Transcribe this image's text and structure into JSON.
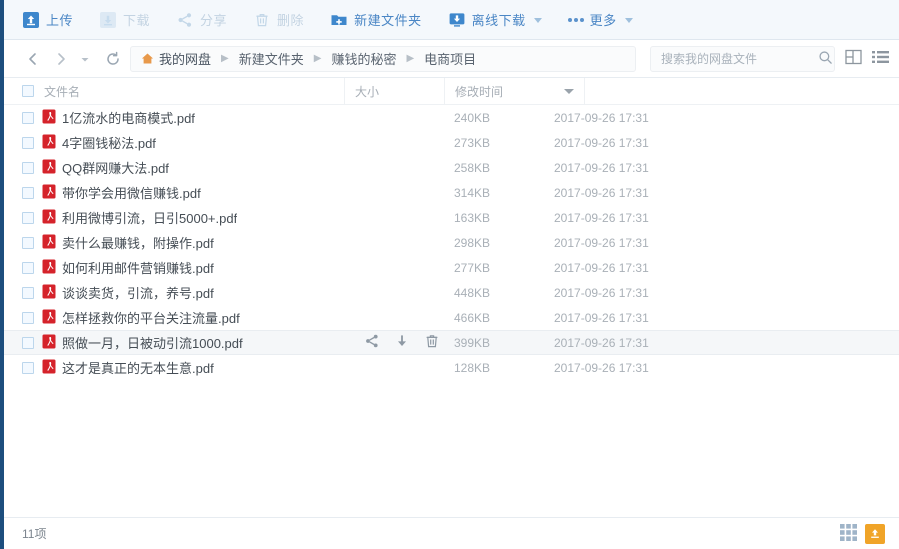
{
  "toolbar": {
    "buttons": [
      {
        "label": "上传",
        "icon": "upload-icon",
        "disabled": false,
        "caret": false
      },
      {
        "label": "下载",
        "icon": "download-icon",
        "disabled": true,
        "caret": false
      },
      {
        "label": "分享",
        "icon": "share-icon",
        "disabled": true,
        "caret": false
      },
      {
        "label": "删除",
        "icon": "trash-icon",
        "disabled": true,
        "caret": false
      },
      {
        "label": "新建文件夹",
        "icon": "new-folder-icon",
        "disabled": false,
        "caret": false
      },
      {
        "label": "离线下载",
        "icon": "offline-download-icon",
        "disabled": false,
        "caret": true
      },
      {
        "label": "更多",
        "icon": "more-dots-icon",
        "disabled": false,
        "caret": true
      }
    ]
  },
  "nav": {
    "back_icon": "arrow-left-icon",
    "forward_icon": "arrow-right-icon",
    "history_icon": "chevron-down-icon",
    "refresh_icon": "refresh-icon",
    "breadcrumb": [
      {
        "label": "我的网盘",
        "icon": "home-icon"
      },
      {
        "label": "新建文件夹",
        "icon": ""
      },
      {
        "label": "赚钱的秘密",
        "icon": ""
      },
      {
        "label": "电商项目",
        "icon": ""
      }
    ],
    "separator": "▶",
    "search": {
      "placeholder": "搜索我的网盘文件",
      "value": "",
      "icon": "search-icon"
    },
    "view_toggles": [
      {
        "name": "panel-view-icon"
      },
      {
        "name": "list-view-icon"
      }
    ]
  },
  "columns": {
    "name": "文件名",
    "size": "大小",
    "time": "修改时间"
  },
  "files": [
    {
      "name": "1亿流水的电商模式.pdf",
      "size": "240KB",
      "time": "2017-09-26 17:31",
      "type": "pdf",
      "hover": false
    },
    {
      "name": "4字圈钱秘法.pdf",
      "size": "273KB",
      "time": "2017-09-26 17:31",
      "type": "pdf",
      "hover": false
    },
    {
      "name": "QQ群网赚大法.pdf",
      "size": "258KB",
      "time": "2017-09-26 17:31",
      "type": "pdf",
      "hover": false
    },
    {
      "name": "带你学会用微信赚钱.pdf",
      "size": "314KB",
      "time": "2017-09-26 17:31",
      "type": "pdf",
      "hover": false
    },
    {
      "name": "利用微博引流，日引5000+.pdf",
      "size": "163KB",
      "time": "2017-09-26 17:31",
      "type": "pdf",
      "hover": false
    },
    {
      "name": "卖什么最赚钱，附操作.pdf",
      "size": "298KB",
      "time": "2017-09-26 17:31",
      "type": "pdf",
      "hover": false
    },
    {
      "name": "如何利用邮件营销赚钱.pdf",
      "size": "277KB",
      "time": "2017-09-26 17:31",
      "type": "pdf",
      "hover": false
    },
    {
      "name": "谈谈卖货，引流，养号.pdf",
      "size": "448KB",
      "time": "2017-09-26 17:31",
      "type": "pdf",
      "hover": false
    },
    {
      "name": "怎样拯救你的平台关注流量.pdf",
      "size": "466KB",
      "time": "2017-09-26 17:31",
      "type": "pdf",
      "hover": false
    },
    {
      "name": "照做一月，日被动引流1000.pdf",
      "size": "399KB",
      "time": "2017-09-26 17:31",
      "type": "pdf",
      "hover": true
    },
    {
      "name": "这才是真正的无本生意.pdf",
      "size": "128KB",
      "time": "2017-09-26 17:31",
      "type": "pdf",
      "hover": false
    }
  ],
  "row_actions": [
    {
      "name": "share-icon"
    },
    {
      "name": "download-icon"
    },
    {
      "name": "delete-icon"
    }
  ],
  "footer": {
    "count_label": "11项",
    "grid_icon": "grid-view-icon",
    "transfer_icon": "transfer-list-icon"
  },
  "colors": {
    "accent_blue": "#4a86c5",
    "icon_blue": "#3e87cc",
    "pdf_red": "#d5232b",
    "orange": "#f0a428",
    "rail_navy": "#1d4e7e"
  }
}
